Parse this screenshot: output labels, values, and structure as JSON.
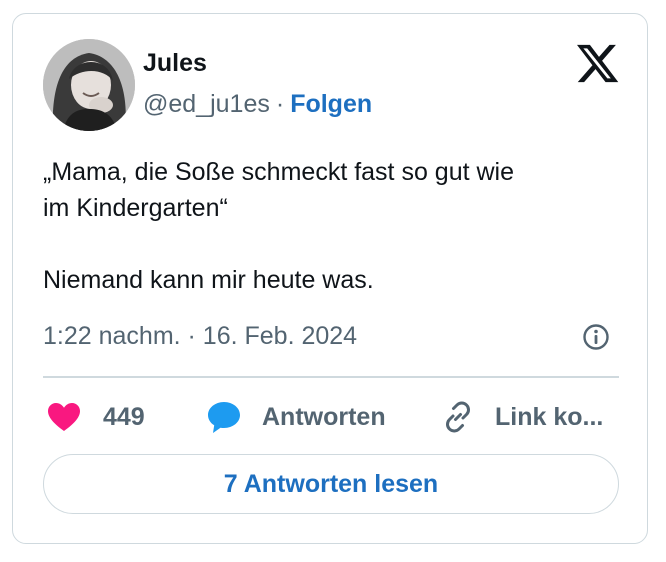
{
  "author": {
    "name": "Jules",
    "handle": "@ed_ju1es",
    "separator": "·",
    "follow_label": "Folgen"
  },
  "tweet": {
    "text": "„Mama, die Soße schmeckt fast so gut wie\nim Kindergarten“\n\nNiemand kann mir heute was.",
    "timestamp": "1:22 nachm. · 16. Feb. 2024"
  },
  "actions": {
    "like_count": "449",
    "reply_label": "Antworten",
    "link_label": "Link ko..."
  },
  "footer": {
    "read_replies_label": "7 Antworten lesen"
  },
  "icons": {
    "brand": "x-logo-icon",
    "info": "info-icon",
    "like": "heart-icon",
    "reply": "speech-bubble-icon",
    "link": "link-icon"
  },
  "colors": {
    "accent": "#1d6fc0",
    "like": "#f91880",
    "reply": "#1d9bf0",
    "muted": "#536471",
    "border": "#cfd9de"
  }
}
